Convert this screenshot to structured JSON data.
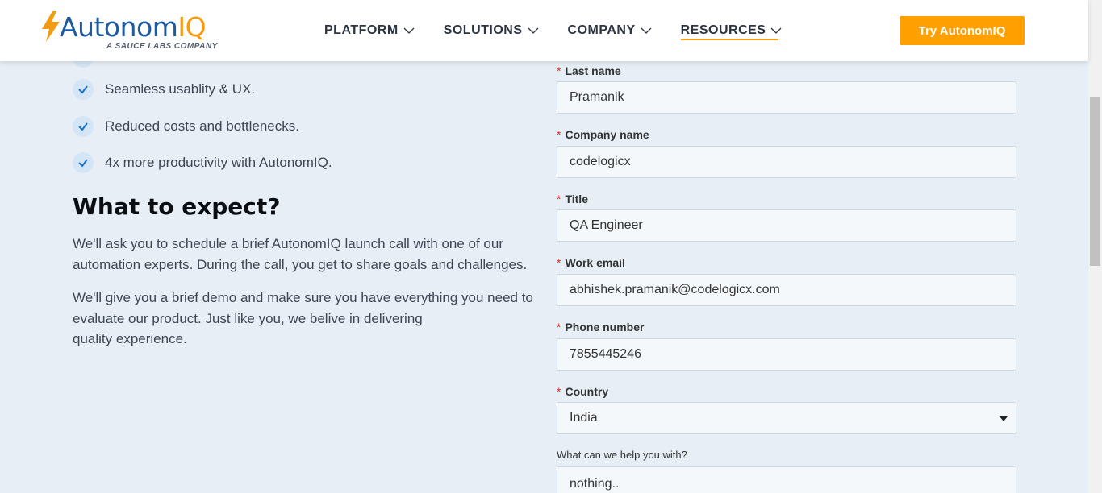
{
  "header": {
    "logo": {
      "name": "Autonom",
      "name_accent": "IQ",
      "tagline": "A SAUCE LABS COMPANY"
    },
    "nav": [
      {
        "label": "PLATFORM"
      },
      {
        "label": "SOLUTIONS"
      },
      {
        "label": "COMPANY"
      },
      {
        "label": "RESOURCES",
        "active": true
      }
    ],
    "cta_label": "Try AutonomIQ"
  },
  "benefits": [
    "Seamless usablity & UX.",
    "Reduced costs and bottlenecks.",
    "4x more productivity with AutonomIQ."
  ],
  "expect": {
    "heading": "What to expect?",
    "para1": "We'll ask you to schedule a brief AutonomIQ launch call with one of our automation experts. During the call, you get to share goals and challenges.",
    "para2_line1": "We'll give you a brief demo and make sure you have everything you need to evaluate our product. Just like you, we belive in delivering",
    "para2_line2": "quality experience."
  },
  "form": {
    "last_name": {
      "label": "Last name",
      "value": "Pramanik"
    },
    "company": {
      "label": "Company name",
      "value": "codelogicx"
    },
    "title": {
      "label": "Title",
      "value": "QA Engineer"
    },
    "email": {
      "label": "Work email",
      "value": "abhishek.pramanik@codelogicx.com"
    },
    "phone": {
      "label": "Phone number",
      "value": "7855445246"
    },
    "country": {
      "label": "Country",
      "value": "India"
    },
    "help": {
      "label": "What can we help you with?",
      "value": "nothing.."
    },
    "required_mark": "*"
  },
  "colors": {
    "accent": "#ffa000",
    "brand_blue": "#1e5a9e",
    "background": "#e7eef5",
    "required": "#d93025"
  }
}
